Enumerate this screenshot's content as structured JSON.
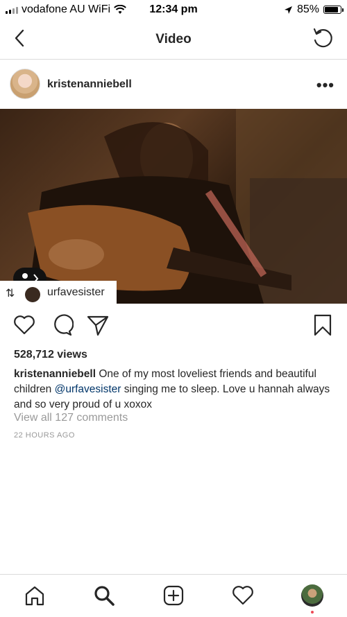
{
  "status_bar": {
    "carrier": "vodafone AU WiFi",
    "time": "12:34 pm",
    "battery_percent": "85%",
    "battery_level": 0.85
  },
  "nav": {
    "title": "Video"
  },
  "post": {
    "username": "kristenanniebell",
    "tagged_user": "urfavesister",
    "views": "528,712 views",
    "caption_user": "kristenanniebell",
    "caption_text_1": " One of my most loveliest friends and beautiful children ",
    "caption_mention": "@urfavesister",
    "caption_text_2": " singing me to sleep. Love u hannah always and so very proud of u xoxox",
    "view_comments": "View all 127 comments",
    "time_ago": "22 HOURS AGO"
  }
}
